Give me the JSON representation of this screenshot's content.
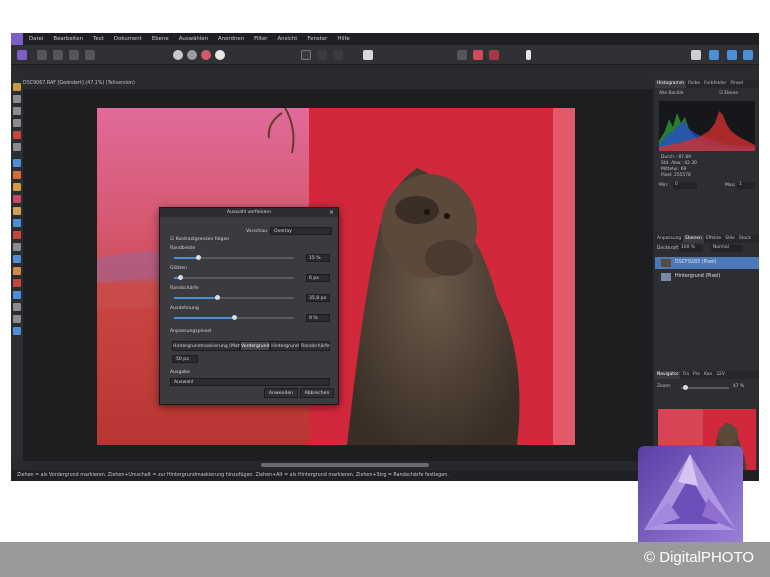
{
  "menu": [
    "Datei",
    "Bearbeiten",
    "Text",
    "Dokument",
    "Ebene",
    "Auswählen",
    "Anordnen",
    "Filter",
    "Ansicht",
    "Fenster",
    "Hilfe"
  ],
  "document_tab": "DSC9067.RAF [Geändert] (47.1%) (Teilversion)",
  "dialog": {
    "title": "Auswahl verfeinern",
    "preview_label": "Vorschau",
    "preview_value": "Overlay",
    "checkbox_label": "Kontrastgrenzen folgen",
    "sliders": [
      {
        "label": "Randbreite",
        "value": "15 %",
        "fraction": 0.2
      },
      {
        "label": "Glätten",
        "value": "6 px",
        "fraction": 0.05
      },
      {
        "label": "Randschärfe",
        "value": "35,8 px",
        "fraction": 0.36
      },
      {
        "label": "Ausdehnung",
        "value": "9 %",
        "fraction": 0.5
      }
    ],
    "brush_label": "Anpassungspinsel",
    "segments": [
      "Hintergrundmaskierung (Matte)",
      "Vordergrund",
      "Hintergrund",
      "Randschärfe"
    ],
    "active_segment": "Vordergrund",
    "brush_size": "50 px",
    "output_label": "Ausgabe",
    "output_value": "Auswahl",
    "apply": "Anwenden",
    "cancel": "Abbrechen"
  },
  "panels": {
    "top_tabs": [
      "Histogramm",
      "Farbe",
      "Farbfelder",
      "Pinsel"
    ],
    "channel_select": "Alle Kanäle",
    "layer_checkbox": "Ebene",
    "stats_left": [
      "Durch.: 87.89",
      "Std. Abw.: 42.30",
      "Mittelw.: 69",
      "Pixel: 255578"
    ],
    "min_label": "Min:",
    "min_value": "0",
    "max_label": "Max:",
    "max_value": "1",
    "mid_tabs": [
      "Anpassung",
      "Ebenen",
      "Effekte",
      "Stile",
      "Stock"
    ],
    "opacity_label": "Deckkraft:",
    "opacity_value": "100 %",
    "blend_mode": "Normal",
    "layers": [
      "DSCF9283 (Pixel)",
      "Hintergrund (Pixel)"
    ],
    "nav_tabs": [
      "Navigator",
      "Tra",
      "Pro",
      "Kan",
      "32V"
    ],
    "zoom_label": "Zoom:",
    "zoom_value": "47 %"
  },
  "status": "Ziehen = als Vordergrund markieren. Ziehen+Umschalt = zur Hintergrundmaskierung hinzufügen. Ziehen+Alt = als Hintergrund markieren. Ziehen+Strg = Randschärfe festlegen.",
  "credit": "© DigitalPHOTO",
  "colors": {
    "accent": "#4c8fd6",
    "selection_overlay": "#d64455",
    "logo_purple": "#8a67c8"
  }
}
